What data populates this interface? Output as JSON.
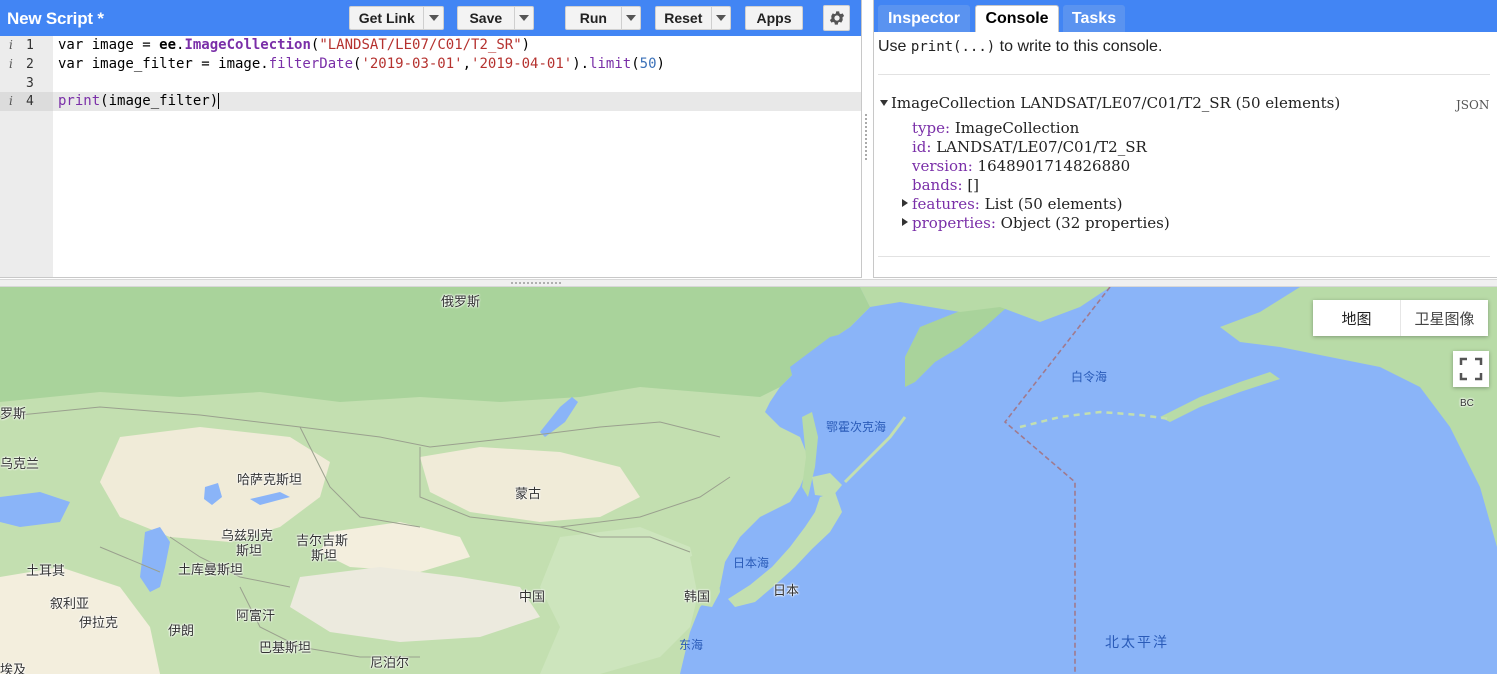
{
  "editor": {
    "title": "New Script *",
    "buttons": {
      "get_link": "Get Link",
      "save": "Save",
      "run": "Run",
      "reset": "Reset",
      "apps": "Apps"
    },
    "line_numbers": [
      "1",
      "2",
      "3",
      "4"
    ],
    "info_marker": "i",
    "code": {
      "line1": {
        "p1": "var image = ",
        "p2": "ee",
        "p3": ".",
        "p4": "ImageCollection",
        "p5": "(",
        "p6": "\"LANDSAT/LE07/C01/T2_SR\"",
        "p7": ")"
      },
      "line2": {
        "p1": "var image_filter = image.",
        "p2": "filterDate",
        "p3": "(",
        "p4": "'2019-03-01'",
        "p5": ",",
        "p6": "'2019-04-01'",
        "p7": ").",
        "p8": "limit",
        "p9": "(",
        "p10": "50",
        "p11": ")"
      },
      "line4": {
        "p1": "print",
        "p2": "(image_filter)"
      }
    }
  },
  "panel": {
    "tabs": [
      "Inspector",
      "Console",
      "Tasks"
    ],
    "active_tab": "Console",
    "hint": {
      "pre": "Use ",
      "code": "print(...)",
      "post": " to write to this console."
    },
    "output": {
      "header": "ImageCollection LANDSAT/LE07/C01/T2_SR (50 elements)",
      "json_link": "JSON",
      "props": [
        {
          "key": "type:",
          "value": " ImageCollection"
        },
        {
          "key": "id:",
          "value": " LANDSAT/LE07/C01/T2_SR"
        },
        {
          "key": "version:",
          "value": " 1648901714826880"
        },
        {
          "key": "bands:",
          "value": " []"
        },
        {
          "key": "features:",
          "value": " List (50 elements)"
        },
        {
          "key": "properties:",
          "value": " Object (32 properties)"
        }
      ]
    }
  },
  "map": {
    "map_type_buttons": [
      "地图",
      "卫星图像"
    ],
    "labels": {
      "russia": "俄罗斯",
      "kazakhstan": "哈萨克斯坦",
      "mongolia": "蒙古",
      "uzbekistan_1": "乌兹别克",
      "uzbekistan_2": "斯坦",
      "kyrgyzstan_1": "吉尔吉斯",
      "kyrgyzstan_2": "斯坦",
      "turkmenistan": "土库曼斯坦",
      "turkey": "土耳其",
      "syria": "叙利亚",
      "iraq": "伊拉克",
      "iran": "伊朗",
      "afghanistan": "阿富汗",
      "pakistan": "巴基斯坦",
      "nepal": "尼泊尔",
      "china": "中国",
      "korea": "韩国",
      "japan": "日本",
      "ukraine": "乌克兰",
      "romania_partial": "罗斯",
      "egypt_partial": "埃及",
      "bc": "BC"
    },
    "seas": {
      "okhotsk": "鄂霍次克海",
      "bering": "白令海",
      "sea_of_japan": "日本海",
      "east_china_sea": "东海",
      "north_pacific": "北太平洋"
    },
    "colors": {
      "water": "#8ab4f8",
      "forest": "#a8d5a0",
      "steppe": "#c5e0b4",
      "desert": "#f1ecd9",
      "accent": "#4285f4"
    }
  }
}
